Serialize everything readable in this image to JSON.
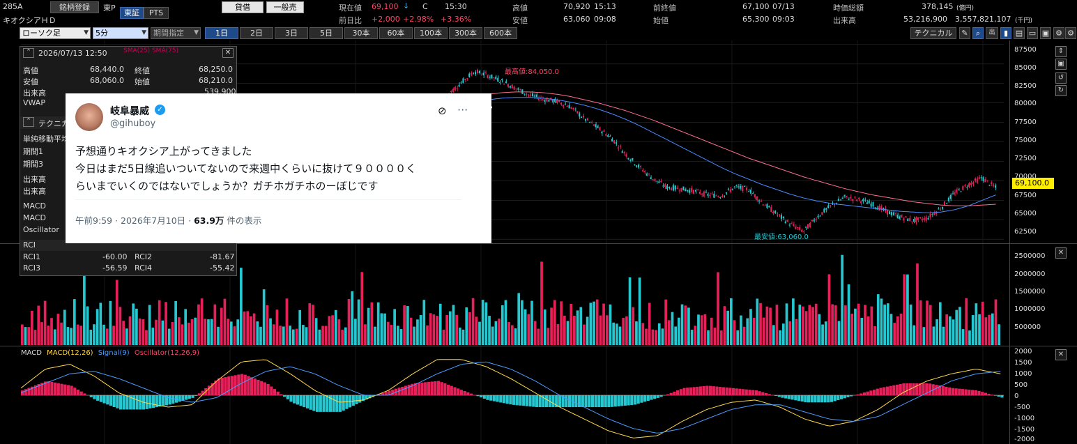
{
  "header": {
    "code": "285A",
    "name": "キオクシアＨＤ",
    "register_btn": "銘柄登録",
    "market_label": "東P",
    "exch_btn1": "東証",
    "exch_btn2": "PTS",
    "loan_btn": "貸借",
    "general_btn": "一般売",
    "current_label": "現在値",
    "current_value": "69,100",
    "current_arrow": "↓",
    "current_flag": "C",
    "current_time": "15:30",
    "change_label": "前日比",
    "change_value": "+2,000",
    "change_pct1": "+2.98%",
    "change_pct2": "+3.36%",
    "high_label": "高値",
    "high_value": "70,920",
    "high_time": "15:13",
    "low_label": "安値",
    "low_value": "63,060",
    "low_time": "09:08",
    "prev_label": "前終値",
    "prev_value": "67,100",
    "prev_date": "07/13",
    "open_label": "始値",
    "open_value": "65,300",
    "open_time": "09:03",
    "mcap_label": "時価総額",
    "mcap_value": "378,145",
    "mcap_unit": "(億円)",
    "volume_label": "出来高",
    "volume_value": "53,216,900",
    "turnover_value": "3,557,821,107",
    "turnover_unit": "(千円)"
  },
  "toolbar": {
    "chart_type": "ローソク足",
    "interval": "5分",
    "period": "期間指定",
    "ranges": [
      "1日",
      "2日",
      "3日",
      "5日",
      "30本",
      "60本",
      "100本",
      "300本",
      "600本"
    ],
    "technical_btn": "テクニカル"
  },
  "info_panel": {
    "date": "2026/07/13 12:50",
    "sma_labels": "SMA(25)  SMA(75)",
    "rows": [
      {
        "l1": "高値",
        "v1": "68,440.0",
        "l2": "終値",
        "v2": "68,250.0"
      },
      {
        "l1": "安値",
        "v1": "68,060.0",
        "l2": "始値",
        "v2": "68,210.0"
      },
      {
        "l1": "出来高",
        "v1": "",
        "l2": "",
        "v2": "539,900"
      },
      {
        "l1": "VWAP",
        "v1": "",
        "l2": "",
        "v2": ""
      }
    ],
    "tech_label": "テクニカル",
    "sma_section": "単純移動平均",
    "period1": "期間1",
    "period3": "期間3",
    "vol_section": "出来高",
    "vol_label": "出来高",
    "macd_section": "MACD",
    "macd_label": "MACD",
    "osc_label": "Oscillator",
    "rci_section": "RCI",
    "rci_rows": [
      {
        "l1": "RCI1",
        "v1": "-60.00",
        "l2": "RCI2",
        "v2": "-81.67"
      },
      {
        "l1": "RCI3",
        "v1": "-56.59",
        "l2": "RCI4",
        "v2": "-55.42"
      }
    ]
  },
  "tweet": {
    "display_name": "岐阜暴威",
    "handle": "@gihuboy",
    "line1": "予想通りキオクシア上がってきました",
    "line2": "今日はまだ5日線追いついてないので来週中くらいに抜けて９００００く",
    "line3": "らいまでいくのではないでしょうか？ガチホガチホのーぼじです",
    "time": "午前9:59 · 2026年7月10日 · ",
    "views": "63.9万",
    "views_suffix": " 件の表示"
  },
  "annotations": {
    "max_label": "最高値:84,050.0",
    "min_label": "最安値:63,060.0",
    "price_tag": "69,100.0"
  },
  "macd_legend": {
    "macd": "MACD",
    "macd_param": "MACD(12,26)",
    "signal": "Signal(9)",
    "osc": "Oscillator(12,26,9)"
  },
  "price_axis": [
    "87500",
    "85000",
    "82500",
    "80000",
    "77500",
    "75000",
    "72500",
    "70000",
    "67500",
    "65000",
    "62500"
  ],
  "volume_axis": [
    "2500000",
    "2000000",
    "1500000",
    "1000000",
    "500000"
  ],
  "macd_axis": [
    "2000",
    "1500",
    "1000",
    "500",
    "0",
    "-500",
    "-1000",
    "-1500",
    "-2000"
  ],
  "colors": {
    "up": "#25c8d0",
    "down": "#e8205a",
    "sma25": "#4a8cff",
    "sma75": "#ff6f8f",
    "macd": "#ffd84a",
    "signal": "#4a9cff",
    "price_tag_bg": "#ffee00"
  },
  "chart_data": [
    {
      "type": "line",
      "title": "",
      "series": [
        {
          "name": "close",
          "x": [
            0,
            1,
            2,
            3,
            4,
            5,
            6,
            7,
            8,
            9,
            10,
            11,
            12,
            13,
            14,
            15,
            16,
            17,
            18,
            19,
            20,
            21,
            22,
            23,
            24,
            25,
            26,
            27,
            28,
            29,
            30,
            31,
            32,
            33,
            34,
            35,
            36,
            37,
            38,
            39,
            40
          ],
          "values": [
            81000,
            82500,
            84050,
            83500,
            82800,
            81900,
            81000,
            80500,
            80200,
            79500,
            78000,
            76800,
            75500,
            73500,
            71800,
            70300,
            69200,
            69000,
            68700,
            68200,
            68100,
            69200,
            68900,
            67200,
            65800,
            64500,
            63500,
            65400,
            66800,
            67900,
            67600,
            67000,
            66100,
            65400,
            64900,
            65200,
            66500,
            68400,
            69500,
            70400,
            69100
          ]
        },
        {
          "name": "SMA(25)",
          "values": [
            79500,
            79800,
            80100,
            80400,
            80600,
            80700,
            80700,
            80600,
            80400,
            80100,
            79700,
            79200,
            78600,
            77900,
            77100,
            76200,
            75300,
            74400,
            73500,
            72600,
            71700,
            70900,
            70200,
            69500,
            68900,
            68300,
            67800,
            67400,
            67100,
            66900,
            66700,
            66500,
            66300,
            66100,
            66000,
            65900,
            66000,
            66300,
            66800,
            67500,
            68200
          ]
        },
        {
          "name": "SMA(75)",
          "values": [
            80500,
            80700,
            80900,
            81100,
            81300,
            81400,
            81400,
            81300,
            81100,
            80800,
            80400,
            80000,
            79500,
            79000,
            78400,
            77800,
            77100,
            76400,
            75700,
            75000,
            74300,
            73600,
            72900,
            72300,
            71700,
            71100,
            70500,
            70000,
            69500,
            69000,
            68600,
            68200,
            67900,
            67600,
            67300,
            67100,
            66900,
            66800,
            66800,
            66900,
            67000
          ]
        }
      ],
      "ylim": [
        62000,
        88000
      ]
    },
    {
      "type": "bar",
      "title": "",
      "ylim": [
        0,
        2800000
      ]
    },
    {
      "type": "line",
      "title": "",
      "series": [
        {
          "name": "MACD(12,26)",
          "values": [
            300,
            1100,
            1300,
            800,
            100,
            -300,
            -500,
            -400,
            600,
            1400,
            1500,
            900,
            200,
            -300,
            -200,
            200,
            900,
            1500,
            1500,
            1200,
            700,
            100,
            -500,
            -1000,
            -1500,
            -1800,
            -1700,
            -1100,
            -600,
            -300,
            -200,
            -500,
            -1000,
            -1300,
            -1100,
            -600,
            100,
            600,
            900,
            1100,
            900
          ]
        },
        {
          "name": "Signal(9)",
          "values": [
            100,
            500,
            900,
            1000,
            700,
            300,
            -100,
            -300,
            -100,
            500,
            1000,
            1200,
            900,
            400,
            0,
            0,
            400,
            900,
            1300,
            1400,
            1100,
            600,
            0,
            -500,
            -1000,
            -1400,
            -1600,
            -1400,
            -1000,
            -600,
            -400,
            -400,
            -700,
            -1000,
            -1100,
            -900,
            -400,
            100,
            600,
            900,
            1000
          ]
        },
        {
          "name": "Oscillator(12,26,9)",
          "values": [
            200,
            600,
            400,
            -200,
            -600,
            -600,
            -400,
            -100,
            700,
            900,
            500,
            -300,
            -700,
            -700,
            -200,
            200,
            500,
            600,
            200,
            -200,
            -400,
            -500,
            -500,
            -500,
            -500,
            -400,
            -100,
            300,
            400,
            300,
            200,
            -100,
            -300,
            -300,
            0,
            300,
            500,
            500,
            300,
            200,
            -100
          ]
        }
      ],
      "ylim": [
        -2000,
        2000
      ]
    }
  ]
}
